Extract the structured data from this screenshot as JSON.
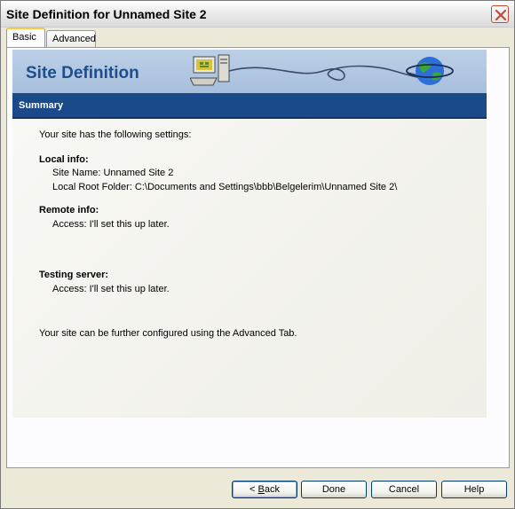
{
  "window": {
    "title": "Site Definition for Unnamed Site 2"
  },
  "tabs": [
    {
      "label": "Basic",
      "active": true
    },
    {
      "label": "Advanced",
      "active": false
    }
  ],
  "banner": {
    "title": "Site Definition",
    "colors": {
      "title": "#1e4d8c",
      "background": "#bccfe6"
    }
  },
  "section": {
    "title": "Summary",
    "color": "#1a4a8a"
  },
  "summary": {
    "intro": "Your site has the following settings:",
    "local_heading": "Local info:",
    "site_name": "Site Name: Unnamed Site 2",
    "local_root": "Local Root Folder: C:\\Documents and Settings\\bbb\\Belgelerim\\Unnamed Site 2\\",
    "remote_heading": "Remote info:",
    "remote_access": "Access: I'll set this up later.",
    "testing_heading": "Testing server:",
    "testing_access": "Access: I'll set this up later.",
    "footer_note": "Your site can be further configured using the Advanced Tab."
  },
  "buttons": {
    "back": {
      "prefix": "< ",
      "mnemonic": "B",
      "rest": "ack"
    },
    "done": "Done",
    "cancel": "Cancel",
    "help": "Help"
  },
  "icons": {
    "close": "close-icon",
    "computer": "computer-icon",
    "globe": "globe-icon"
  }
}
